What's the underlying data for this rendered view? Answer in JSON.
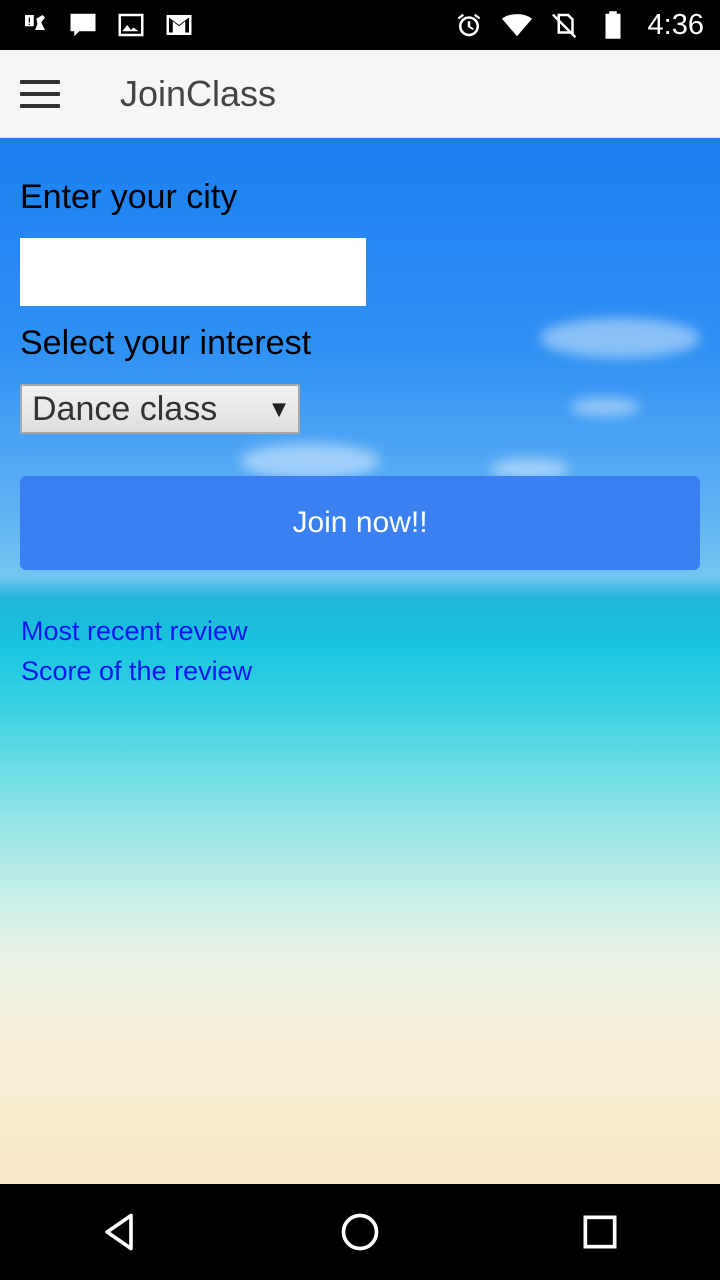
{
  "status_bar": {
    "time": "4:36",
    "left_icons": [
      "alert-robot-icon",
      "message-icon",
      "image-icon",
      "gmail-icon"
    ],
    "right_icons": [
      "alarm-icon",
      "wifi-icon",
      "no-sim-icon",
      "battery-icon"
    ]
  },
  "app_bar": {
    "title": "JoinClass"
  },
  "form": {
    "city_label": "Enter your city",
    "city_value": "",
    "interest_label": "Select your interest",
    "interest_selected": "Dance class",
    "join_button": "Join now!!"
  },
  "links": {
    "recent_review": "Most recent review",
    "review_score": "Score of the review"
  },
  "colors": {
    "button": "#3b80f0",
    "link": "#0b17f2",
    "app_bar": "#f6f6f6"
  }
}
